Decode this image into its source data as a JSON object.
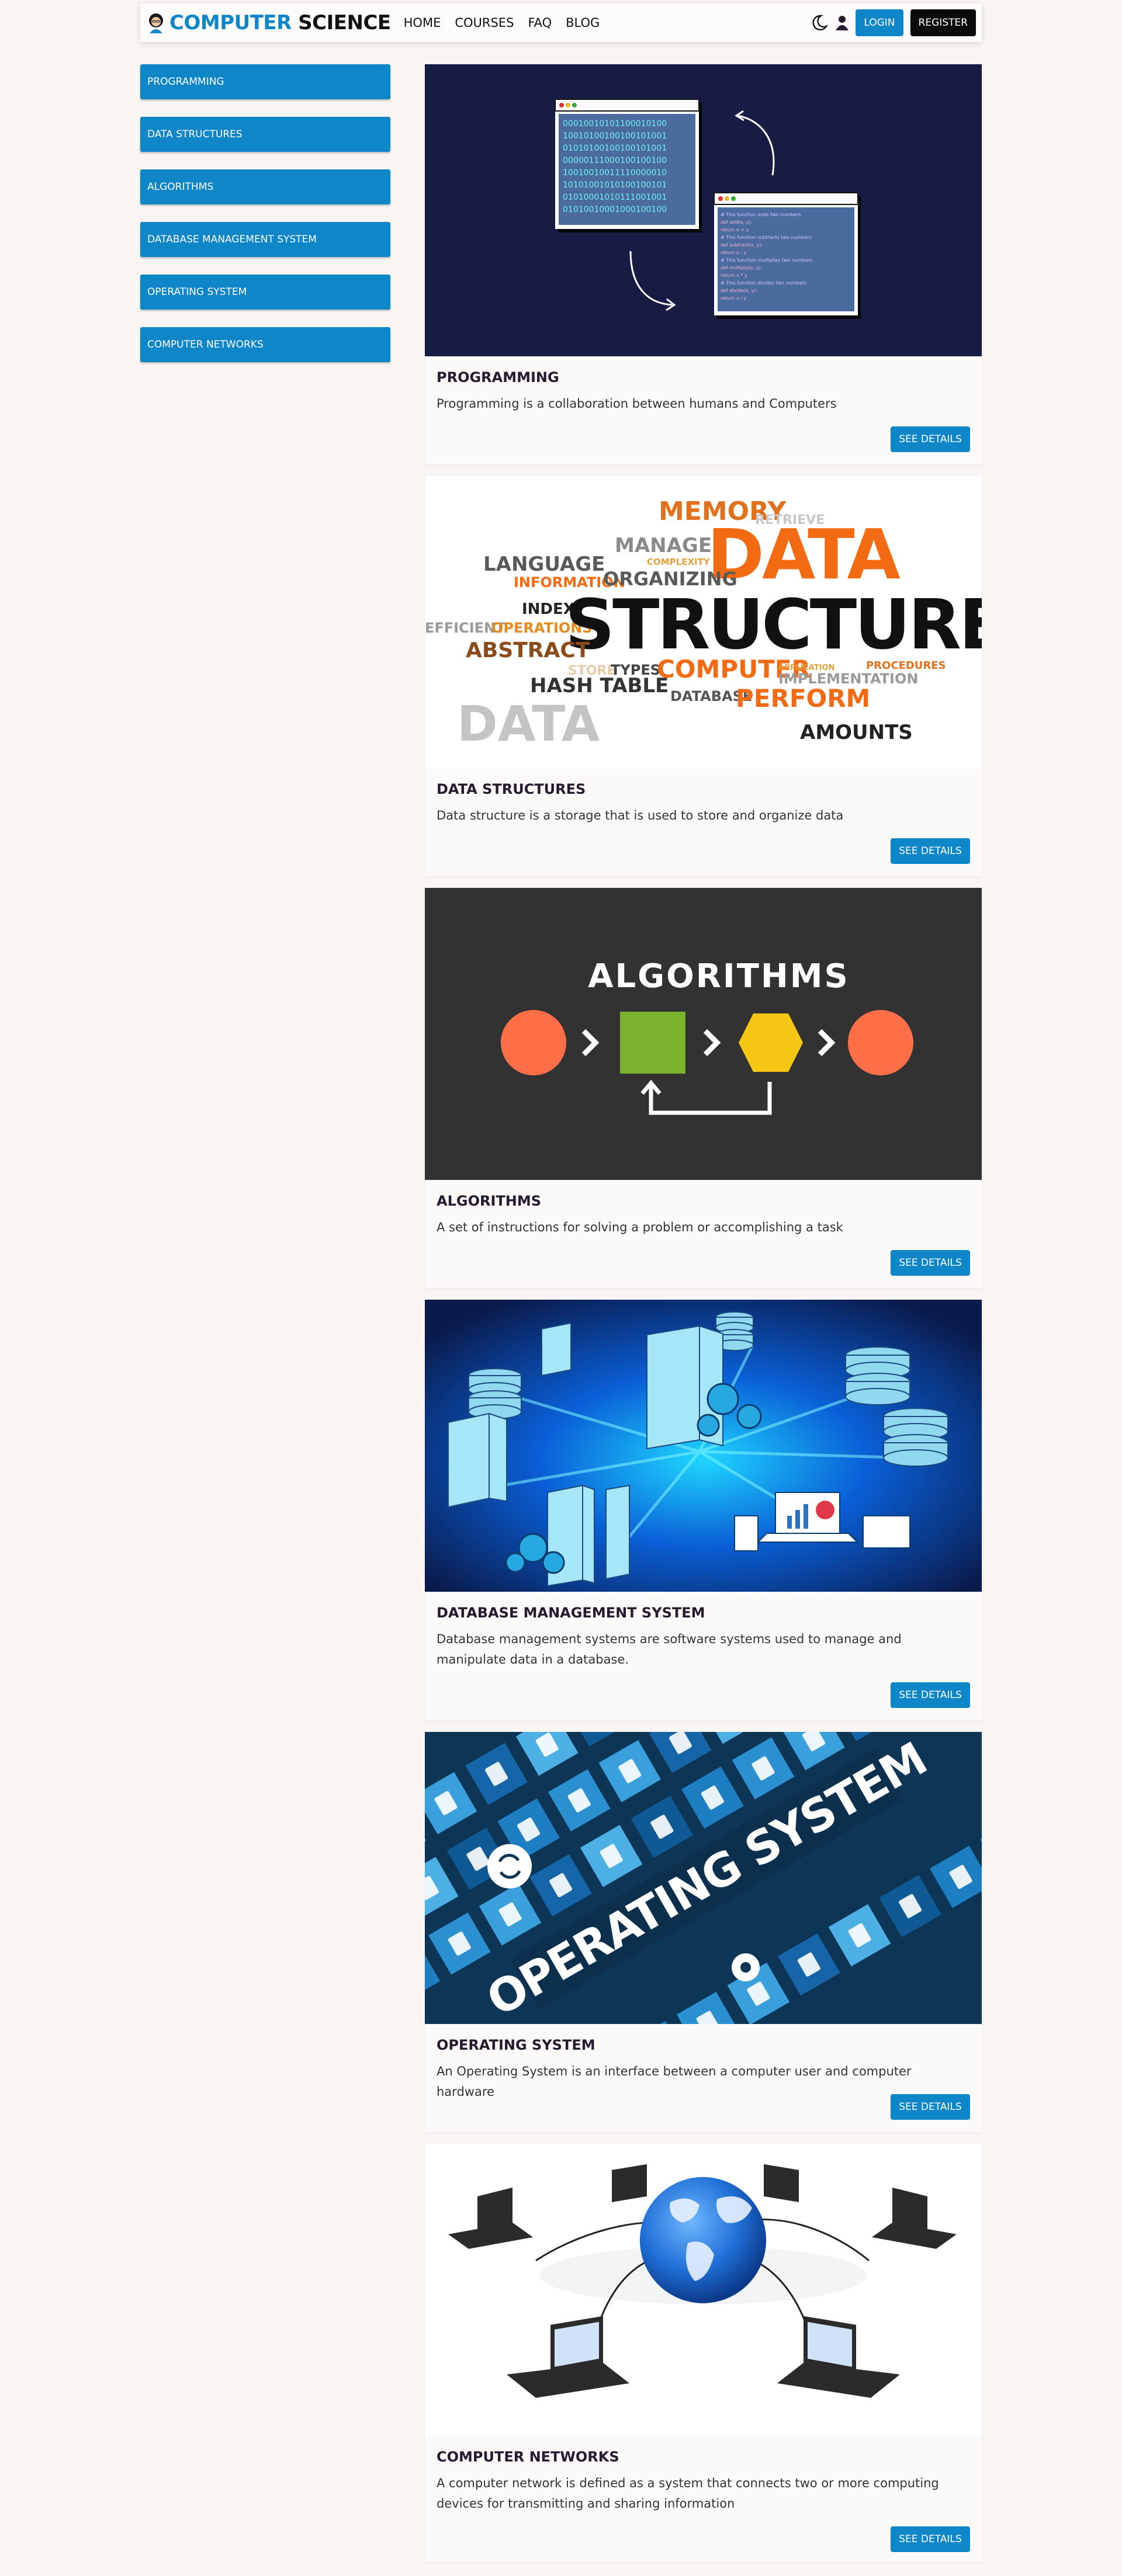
{
  "brand": {
    "part1": "COMPUTER",
    "part2": "SCIENCE",
    "logo_icon": "student-avatar-icon"
  },
  "nav": {
    "home": "HOME",
    "courses": "COURSES",
    "faq": "FAQ",
    "blog": "BLOG"
  },
  "actions": {
    "theme_icon": "moon-icon",
    "user_icon": "user-icon",
    "login": "LOGIN",
    "register": "REGISTER"
  },
  "sidebar": {
    "items": [
      {
        "label": "PROGRAMMING"
      },
      {
        "label": "DATA STRUCTURES"
      },
      {
        "label": "ALGORITHMS"
      },
      {
        "label": "DATABASE MANAGEMENT SYSTEM"
      },
      {
        "label": "OPERATING SYSTEM"
      },
      {
        "label": "COMPUTER NETWORKS"
      }
    ]
  },
  "courses": [
    {
      "title": "PROGRAMMING",
      "description": "Programming is a collaboration between humans and Computers",
      "button": "SEE DETAILS",
      "image_icon": "programming-illustration"
    },
    {
      "title": "DATA STRUCTURES",
      "description": "Data structure is a storage that is used to store and organize data",
      "button": "SEE DETAILS",
      "image_icon": "data-structure-word-cloud"
    },
    {
      "title": "ALGORITHMS",
      "description": "A set of instructions for solving a problem or accomplishing a task",
      "button": "SEE DETAILS",
      "image_icon": "algorithms-flow-illustration"
    },
    {
      "title": "DATABASE MANAGEMENT SYSTEM",
      "description": "Database management systems are software systems used to manage and manipulate data in a database.",
      "button": "SEE DETAILS",
      "image_icon": "database-servers-illustration"
    },
    {
      "title": "OPERATING SYSTEM",
      "description": "An Operating System is an interface between a computer user and computer hardware",
      "button": "SEE DETAILS",
      "image_icon": "operating-system-tiles-illustration"
    },
    {
      "title": "COMPUTER NETWORKS",
      "description": "A computer network is defined as a system that connects two or more computing devices for transmitting and sharing information",
      "button": "SEE DETAILS",
      "image_icon": "globe-network-illustration"
    }
  ],
  "images": {
    "binary_lines": [
      "00010010101100010100",
      "10010100100100101001",
      "01010100100100101001",
      "00000111000100100100",
      "10010010011110000010",
      "10101001010100100101",
      "01010001010111001001",
      "01010010001000100100"
    ],
    "code_lines": [
      "# This function adds two numbers",
      "def add(x, y):",
      "    return x + y",
      "# This function subtracts two numbers",
      "def subtract(x, y):",
      "    return x - y",
      "# This function multiplies two numbers",
      "def multiply(x, y):",
      "    return x * y",
      "# This function divides two numbers",
      "def divide(x, y):",
      "    return x / y"
    ],
    "word_cloud": [
      {
        "text": "MEMORY",
        "color": "#e2711d"
      },
      {
        "text": "RETRIEVE",
        "color": "#c8c8c8"
      },
      {
        "text": "MANAGE",
        "color": "#8a8a8a"
      },
      {
        "text": "COMPLEXITY",
        "color": "#e2a23b"
      },
      {
        "text": "DATA",
        "color": "#f26a12"
      },
      {
        "text": "LANGUAGE",
        "color": "#5a5a5a"
      },
      {
        "text": "INFORMATION",
        "color": "#f26a12"
      },
      {
        "text": "ORGANIZING",
        "color": "#5a5a5a"
      },
      {
        "text": "INDEX",
        "color": "#222222"
      },
      {
        "text": "EFFICIENT",
        "color": "#9a9a9a"
      },
      {
        "text": "OPERATIONS",
        "color": "#e28a1d"
      },
      {
        "text": "STRUCTURE",
        "color": "#111111"
      },
      {
        "text": "ABSTRACT",
        "color": "#8a4a1a"
      },
      {
        "text": "STORE",
        "color": "#e8c9a8"
      },
      {
        "text": "TYPES",
        "color": "#444444"
      },
      {
        "text": "COMPUTER",
        "color": "#f26a12"
      },
      {
        "text": "APPLICATION",
        "color": "#e2a23b"
      },
      {
        "text": "PROCEDURES",
        "color": "#e2711d"
      },
      {
        "text": "IMPLEMENTATION",
        "color": "#9a9a9a"
      },
      {
        "text": "HASH TABLE",
        "color": "#333333"
      },
      {
        "text": "DATABASE",
        "color": "#555555"
      },
      {
        "text": "PERFORM",
        "color": "#f26a12"
      },
      {
        "text": "DATA",
        "color": "#c4c4c4"
      },
      {
        "text": "AMOUNTS",
        "color": "#222222"
      }
    ],
    "algorithms_title": "ALGORITHMS",
    "os_title": "OPERATING SYSTEM"
  },
  "colors": {
    "accent": "#0f86c8",
    "page_bg": "#f8f5f2",
    "title": "#231c2e"
  }
}
